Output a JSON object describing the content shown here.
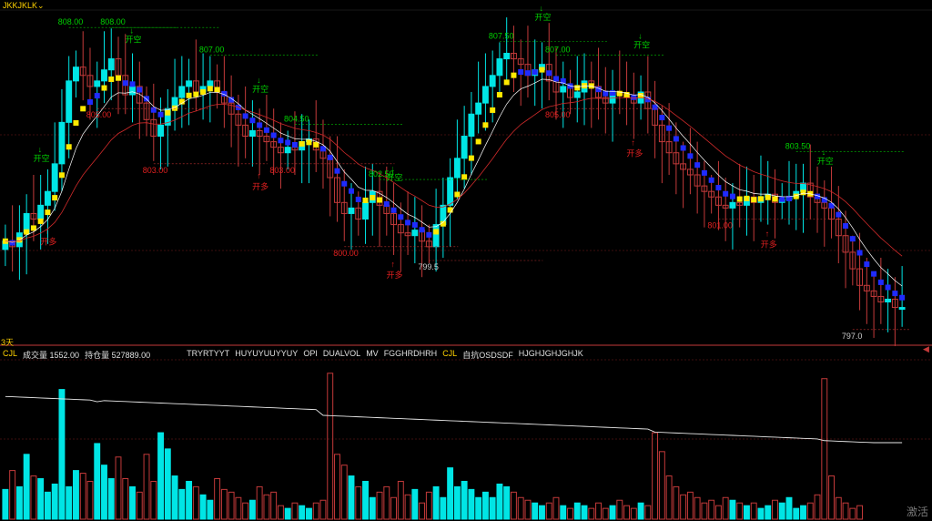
{
  "window": {
    "symbol": "JKKJKLK",
    "period": "3天",
    "watermark": "激活"
  },
  "indicator_bar": {
    "name": "CJL",
    "volume_label": "成交量 1552.00",
    "oi_label": "持仓量 527889.00",
    "items": [
      "TRYRTYYT",
      "HUYUYUUYYUY",
      "OPI",
      "DUALVOL",
      "MV",
      "FGGHRDHRH"
    ],
    "active": "CJL",
    "rest": [
      "自抗OSDSDF",
      "HJGHJGHJGHJK"
    ]
  },
  "colors": {
    "up": "#00e5e5",
    "down": "#c43a3a",
    "bull_dot": "#ffea00",
    "bear_dot": "#1f2bff",
    "signal_up": "#00d000",
    "signal_down": "#e02020",
    "text": "#e0e0e0",
    "accent": "#ffd200"
  },
  "chart_data": [
    {
      "type": "candlestick",
      "title": "",
      "ylim": [
        796.5,
        808.6
      ],
      "price_labels_high": [
        {
          "bar": 9,
          "text": "808.00"
        },
        {
          "bar": 15,
          "text": "808.00"
        },
        {
          "bar": 29,
          "text": "807.00"
        },
        {
          "bar": 70,
          "text": "807.50"
        },
        {
          "bar": 78,
          "text": "807.00"
        },
        {
          "bar": 41,
          "text": "804.50"
        },
        {
          "bar": 53,
          "text": "802.50"
        },
        {
          "bar": 112,
          "text": "803.50"
        }
      ],
      "price_labels_low": [
        {
          "bar": 13,
          "text": "805.00"
        },
        {
          "bar": 21,
          "text": "803.00"
        },
        {
          "bar": 39,
          "text": "803.00"
        },
        {
          "bar": 48,
          "text": "800.00"
        },
        {
          "bar": 60,
          "text": "799.5"
        },
        {
          "bar": 78,
          "text": "805.00"
        },
        {
          "bar": 101,
          "text": "801.00"
        },
        {
          "bar": 120,
          "text": "797.0"
        }
      ],
      "signals": [
        {
          "bar": 5,
          "text": "开空",
          "kind": "short"
        },
        {
          "bar": 18,
          "text": "开空",
          "kind": "short"
        },
        {
          "bar": 36,
          "text": "开空",
          "kind": "short"
        },
        {
          "bar": 55,
          "text": "开空",
          "kind": "short"
        },
        {
          "bar": 76,
          "text": "开空",
          "kind": "short"
        },
        {
          "bar": 90,
          "text": "开空",
          "kind": "short"
        },
        {
          "bar": 116,
          "text": "开空",
          "kind": "short"
        },
        {
          "bar": 36,
          "text": "开多",
          "kind": "long"
        },
        {
          "bar": 55,
          "text": "开多",
          "kind": "long"
        },
        {
          "bar": 89,
          "text": "开多",
          "kind": "long"
        },
        {
          "bar": 108,
          "text": "开多",
          "kind": "long"
        },
        {
          "bar": 6,
          "text": "开多",
          "kind": "long"
        }
      ],
      "close_series": [
        800.2,
        800.0,
        800.5,
        801.2,
        801.0,
        801.5,
        802.0,
        803.0,
        804.5,
        806.0,
        806.5,
        806.2,
        805.8,
        806.0,
        806.4,
        806.8,
        806.2,
        805.5,
        805.8,
        805.2,
        804.6,
        804.0,
        804.4,
        805.0,
        805.4,
        805.8,
        806.0,
        805.6,
        805.8,
        806.0,
        805.6,
        805.2,
        804.8,
        804.4,
        804.0,
        804.2,
        804.0,
        803.8,
        803.6,
        803.4,
        803.6,
        803.5,
        803.8,
        803.9,
        803.5,
        803.2,
        802.5,
        801.6,
        801.2,
        801.4,
        801.0,
        801.6,
        802.0,
        801.5,
        801.2,
        800.8,
        800.5,
        800.4,
        800.6,
        800.2,
        800.0,
        800.8,
        801.5,
        802.5,
        803.2,
        804.0,
        804.8,
        805.2,
        805.8,
        806.2,
        806.8,
        807.0,
        806.8,
        806.6,
        806.2,
        806.4,
        806.6,
        806.0,
        805.6,
        805.8,
        805.4,
        805.6,
        806.0,
        805.8,
        805.4,
        805.2,
        805.6,
        805.5,
        805.4,
        805.2,
        805.6,
        805.0,
        804.4,
        803.8,
        803.4,
        803.0,
        802.8,
        802.6,
        802.2,
        802.0,
        801.8,
        801.5,
        801.4,
        801.6,
        801.5,
        801.8,
        801.6,
        801.8,
        801.9,
        801.6,
        801.7,
        801.8,
        802.0,
        802.3,
        801.8,
        801.6,
        801.4,
        801.0,
        800.4,
        799.8,
        799.2,
        798.6,
        798.4,
        798.2,
        798.0,
        798.1,
        797.8,
        797.8
      ]
    },
    {
      "type": "bar",
      "title": "CJL",
      "series": [
        {
          "name": "成交量",
          "values": [
            55,
            90,
            60,
            120,
            80,
            75,
            50,
            65,
            240,
            60,
            90,
            85,
            70,
            140,
            100,
            75,
            115,
            75,
            60,
            50,
            120,
            70,
            160,
            130,
            80,
            55,
            70,
            60,
            45,
            35,
            75,
            55,
            50,
            40,
            30,
            35,
            60,
            45,
            50,
            25,
            20,
            30,
            25,
            20,
            30,
            35,
            270,
            120,
            100,
            80,
            60,
            70,
            40,
            50,
            60,
            40,
            70,
            45,
            55,
            30,
            50,
            60,
            40,
            95,
            60,
            70,
            55,
            40,
            50,
            40,
            65,
            60,
            50,
            40,
            35,
            30,
            25,
            30,
            40,
            25,
            20,
            30,
            25,
            20,
            30,
            20,
            25,
            35,
            25,
            20,
            30,
            25,
            160,
            125,
            80,
            60,
            45,
            50,
            40,
            30,
            35,
            25,
            40,
            35,
            30,
            25,
            30,
            20,
            25,
            35,
            30,
            40,
            20,
            25,
            30,
            45,
            260,
            80,
            40,
            30,
            20,
            25
          ]
        }
      ],
      "ylim": [
        0,
        300
      ]
    }
  ]
}
